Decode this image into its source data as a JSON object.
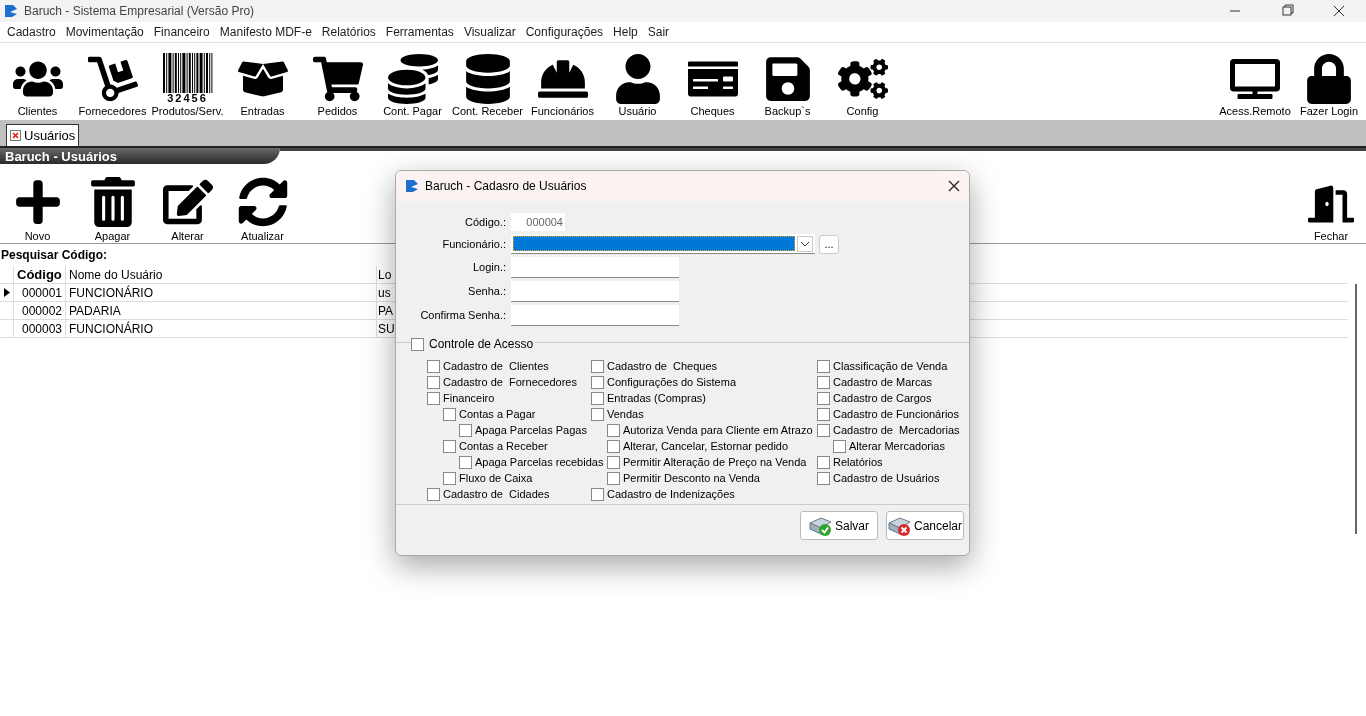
{
  "window": {
    "title": "Baruch - Sistema Empresarial (Versão Pro)"
  },
  "menu": [
    "Cadastro",
    "Movimentação",
    "Financeiro",
    "Manifesto MDF-e",
    "Relatórios",
    "Ferramentas",
    "Visualizar",
    "Configurações",
    "Help",
    "Sair"
  ],
  "toolbar": [
    {
      "kind": "users",
      "label": "Clientes"
    },
    {
      "kind": "dolly",
      "label": "Fornecedores"
    },
    {
      "kind": "barcode",
      "label": "Produtos/Serv.",
      "digits": "32456"
    },
    {
      "kind": "box",
      "label": "Entradas"
    },
    {
      "kind": "cart",
      "label": "Pedidos"
    },
    {
      "kind": "coins",
      "label": "Cont. Pagar"
    },
    {
      "kind": "stack",
      "label": "Cont. Receber"
    },
    {
      "kind": "worker",
      "label": "Funcionários"
    },
    {
      "kind": "user",
      "label": "Usuário"
    },
    {
      "kind": "check",
      "label": "Cheques"
    },
    {
      "kind": "save",
      "label": "Backup`s"
    },
    {
      "kind": "cogs",
      "label": "Config"
    }
  ],
  "toolbar_right": [
    {
      "kind": "remote",
      "label": "Acess.Remoto"
    },
    {
      "kind": "lock",
      "label": "Fazer Login"
    }
  ],
  "tabs": [
    {
      "label": "Usuários",
      "selected": true
    }
  ],
  "module": {
    "title": "Baruch - Usuários",
    "actions": [
      {
        "kind": "plus",
        "label": "Novo"
      },
      {
        "kind": "trash",
        "label": "Apagar"
      },
      {
        "kind": "edit",
        "label": "Alterar"
      },
      {
        "kind": "sync",
        "label": "Atualizar"
      }
    ],
    "close": {
      "label": "Fechar"
    },
    "search_label": "Pesquisar Código:",
    "table": {
      "columns": [
        "Código",
        "Nome do Usuário",
        "Lo"
      ],
      "rows": [
        {
          "cells": [
            "000001",
            "FUNCIONÁRIO",
            "us"
          ],
          "selected": true
        },
        {
          "cells": [
            "000002",
            "PADARIA",
            "PA"
          ],
          "selected": false
        },
        {
          "cells": [
            "000003",
            "FUNCIONÁRIO",
            "SU"
          ],
          "selected": false
        }
      ]
    }
  },
  "dialog": {
    "title": "Baruch - Cadasro de Usuários",
    "codigo": {
      "label": "Código.:",
      "value": "000004"
    },
    "funcionario": {
      "label": "Funcionário.:",
      "button": "..."
    },
    "fields": [
      {
        "label": "Login.:"
      },
      {
        "label": "Senha.:"
      },
      {
        "label": "Confirma Senha.:"
      }
    ],
    "access": {
      "label": "Controle de Acesso",
      "checked": false,
      "columns": [
        [
          {
            "label": "Cadastro de  Clientes",
            "checked": false
          },
          {
            "label": "Cadastro de  Fornecedores",
            "checked": false
          },
          {
            "label": "Financeiro",
            "checked": false,
            "children": [
              {
                "label": "Contas a Pagar",
                "checked": false,
                "children": [
                  {
                    "label": "Apaga Parcelas Pagas",
                    "checked": false
                  }
                ]
              },
              {
                "label": "Contas a Receber",
                "checked": false,
                "children": [
                  {
                    "label": "Apaga Parcelas recebidas",
                    "checked": false
                  }
                ]
              },
              {
                "label": "Fluxo de Caixa",
                "checked": false
              }
            ]
          },
          {
            "label": "Cadastro de  Cidades",
            "checked": false
          }
        ],
        [
          {
            "label": "Cadastro de  Cheques",
            "checked": false
          },
          {
            "label": "Configurações do Sistema",
            "checked": false
          },
          {
            "label": "Entradas (Compras)",
            "checked": false
          },
          {
            "label": "Vendas",
            "checked": false,
            "children": [
              {
                "label": "Autoriza Venda para Cliente em Atrazo",
                "checked": false
              },
              {
                "label": "Alterar, Cancelar, Estornar pedido",
                "checked": false
              },
              {
                "label": "Permitir Alteração de Preço na Venda",
                "checked": false
              },
              {
                "label": "Permitir Desconto na Venda",
                "checked": false
              }
            ]
          },
          {
            "label": "Cadastro de Indenizações",
            "checked": false
          }
        ],
        [
          {
            "label": "Classificação de Venda",
            "checked": false
          },
          {
            "label": "Cadastro de Marcas",
            "checked": false
          },
          {
            "label": "Cadastro de Cargos",
            "checked": false
          },
          {
            "label": "Cadastro de Funcionários",
            "checked": false
          },
          {
            "label": "Cadastro de  Mercadorias",
            "checked": false,
            "children": [
              {
                "label": "Alterar Mercadorias",
                "checked": false
              }
            ]
          },
          {
            "label": "Relatórios",
            "checked": false
          },
          {
            "label": "Cadastro de Usuários",
            "checked": false
          }
        ]
      ]
    },
    "buttons": [
      {
        "kind": "save",
        "label": "Salvar"
      },
      {
        "kind": "cancel",
        "label": "Cancelar"
      }
    ]
  }
}
